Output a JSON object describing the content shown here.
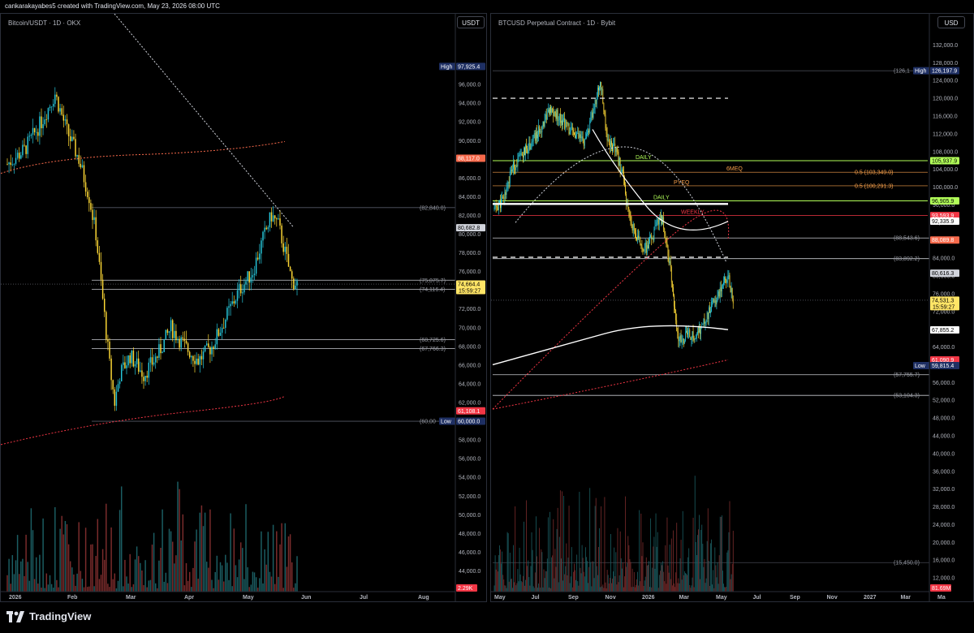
{
  "header": {
    "text": "cankarakayabes5 created with TradingView.com, May 23, 2026 08:00 UTC"
  },
  "footer": {
    "brand": "TradingView"
  },
  "chart_data": [
    {
      "type": "candlestick",
      "title": "Bitcoin/USDT · 1D · OKX",
      "currency": "USDT",
      "ylim": [
        43000,
        100000
      ],
      "yticks": [
        "96,000.0",
        "94,000.0",
        "92,000.0",
        "90,000.0",
        "88,000.0",
        "86,000.0",
        "84,000.0",
        "82,000.0",
        "80,000.0",
        "78,000.0",
        "76,000.0",
        "74,000.0",
        "72,000.0",
        "70,000.0",
        "68,000.0",
        "66,000.0",
        "64,000.0",
        "62,000.0",
        "60,000.0",
        "58,000.0",
        "56,000.0",
        "54,000.0",
        "52,000.0",
        "50,000.0",
        "48,000.0",
        "46,000.0",
        "44,000.0"
      ],
      "xticks": [
        "2026",
        "Feb",
        "Mar",
        "Apr",
        "May",
        "Jun",
        "Jul",
        "Aug"
      ],
      "price_path": [
        [
          0,
          87500
        ],
        [
          10,
          89000
        ],
        [
          20,
          92000
        ],
        [
          28,
          95000
        ],
        [
          35,
          91000
        ],
        [
          42,
          88000
        ],
        [
          48,
          84000
        ],
        [
          52,
          80000
        ],
        [
          56,
          73000
        ],
        [
          60,
          66000
        ],
        [
          63,
          62000
        ],
        [
          66,
          65000
        ],
        [
          72,
          67000
        ],
        [
          80,
          65000
        ],
        [
          88,
          67000
        ],
        [
          96,
          70000
        ],
        [
          104,
          68000
        ],
        [
          112,
          66500
        ],
        [
          120,
          68000
        ],
        [
          128,
          71000
        ],
        [
          136,
          74000
        ],
        [
          144,
          76000
        ],
        [
          150,
          79500
        ],
        [
          155,
          82000
        ],
        [
          159,
          81000
        ],
        [
          163,
          78000
        ],
        [
          167,
          75000
        ],
        [
          170,
          74700
        ]
      ],
      "levels": [
        {
          "value": 82840.0,
          "label": "(82,840.0)",
          "color": "#555a66"
        },
        {
          "value": 75075.7,
          "label": "(75,075.7)",
          "color": "#c8cad0"
        },
        {
          "value": 74116.4,
          "label": "(74,116.4)",
          "color": "#c8cad0"
        },
        {
          "value": 68725.6,
          "label": "(68,725.6)",
          "color": "#c8cad0"
        },
        {
          "value": 67766.3,
          "label": "(67,766.3)",
          "color": "#c8cad0"
        },
        {
          "value": 60000.0,
          "label": "(60,00",
          "color": "#555a66"
        }
      ],
      "price_tags": [
        {
          "value": 97925.4,
          "prefix": "High",
          "text": "97,925.4",
          "bg": "#1e2f63",
          "fg": "#ffffff"
        },
        {
          "value": 88117.0,
          "text": "88,117.0",
          "bg": "#f7694b",
          "fg": "#ffffff"
        },
        {
          "value": 80682.8,
          "text": "80,682.8",
          "bg": "#d1d4dc",
          "fg": "#000000"
        },
        {
          "value": 74664.4,
          "text": "74,664.4",
          "sub": "15:59:27",
          "bg": "#ffe566",
          "fg": "#000000"
        },
        {
          "value": 61108.1,
          "text": "61,108.1",
          "bg": "#f23645",
          "fg": "#ffffff"
        },
        {
          "value": 60000.0,
          "prefix": "Low",
          "text": "60,000.0",
          "bg": "#1e2f63",
          "fg": "#ffffff"
        }
      ],
      "volume_label": "2.29K",
      "colors": {
        "bull": "#26c6da",
        "bear": "#fdd835",
        "ma": "#f7694b",
        "trend": "#d1d4dc"
      }
    },
    {
      "type": "candlestick",
      "title": "BTCUSD Perpetual Contract · 1D · Bybit",
      "currency": "USD",
      "ylim": [
        8000,
        135000
      ],
      "yticks": [
        "132,000.0",
        "128,000.0",
        "124,000.0",
        "120,000.0",
        "116,000.0",
        "112,000.0",
        "108,000.0",
        "104,000.0",
        "100,000.0",
        "96,000.0",
        "92,000.0",
        "88,000.0",
        "84,000.0",
        "80,000.0",
        "76,000.0",
        "72,000.0",
        "68,000.0",
        "64,000.0",
        "60,000.0",
        "56,000.0",
        "52,000.0",
        "48,000.0",
        "44,000.0",
        "40,000.0",
        "36,000.0",
        "32,000.0",
        "28,000.0",
        "24,000.0",
        "20,000.0",
        "16,000.0",
        "12,000.0"
      ],
      "xticks": [
        "May",
        "Jul",
        "Sep",
        "Nov",
        "2026",
        "Mar",
        "May",
        "Jul",
        "Sep",
        "Nov",
        "2027",
        "Mar",
        "Ma"
      ],
      "price_path": [
        [
          0,
          95000
        ],
        [
          10,
          97000
        ],
        [
          20,
          104000
        ],
        [
          35,
          108000
        ],
        [
          50,
          112000
        ],
        [
          62,
          117000
        ],
        [
          75,
          116000
        ],
        [
          90,
          112000
        ],
        [
          105,
          110000
        ],
        [
          115,
          118000
        ],
        [
          122,
          124000
        ],
        [
          130,
          111000
        ],
        [
          140,
          108000
        ],
        [
          148,
          103000
        ],
        [
          152,
          96000
        ],
        [
          158,
          92000
        ],
        [
          165,
          88000
        ],
        [
          175,
          86000
        ],
        [
          185,
          90000
        ],
        [
          192,
          94000
        ],
        [
          198,
          88000
        ],
        [
          205,
          78000
        ],
        [
          210,
          67000
        ],
        [
          215,
          65000
        ],
        [
          222,
          67000
        ],
        [
          232,
          66000
        ],
        [
          240,
          69000
        ],
        [
          250,
          73000
        ],
        [
          258,
          76000
        ],
        [
          265,
          80000
        ],
        [
          270,
          79000
        ],
        [
          275,
          75000
        ]
      ],
      "levels": [
        {
          "value": 126198.0,
          "label": "(126,1",
          "color": "#434651"
        },
        {
          "value": 88543.6,
          "label": "(88,543.6)",
          "color": "#c8cad0"
        },
        {
          "value": 83892.2,
          "label": "(83,892.2)",
          "color": "#c8cad0"
        },
        {
          "value": 57755.7,
          "label": "(57,755.7)",
          "color": "#c8cad0"
        },
        {
          "value": 53104.3,
          "label": "(53,104.3)",
          "color": "#c8cad0"
        },
        {
          "value": 15450.0,
          "label": "(15,450.0)",
          "color": "#434651"
        }
      ],
      "annotations": [
        {
          "value": 105937.9,
          "label": "DAILY",
          "color": "#b2ff59"
        },
        {
          "value": 103349.0,
          "label": "6MEQ",
          "right": "0.5 (103,349.0)",
          "color": "#f7a04b"
        },
        {
          "value": 100291.3,
          "label": "PYEQ",
          "right": "0.5 (100,291.3)",
          "color": "#f7a04b"
        },
        {
          "value": 96905.9,
          "label": "DAILY",
          "color": "#b2ff59"
        },
        {
          "value": 93593.9,
          "label": "WEEKLY",
          "color": "#f23645"
        }
      ],
      "price_tags": [
        {
          "value": 126197.9,
          "prefix": "High",
          "text": "126,197.9",
          "bg": "#1e2f63",
          "fg": "#ffffff"
        },
        {
          "value": 105937.9,
          "text": "105,937.9",
          "bg": "#b2ff59",
          "fg": "#000000"
        },
        {
          "value": 96905.9,
          "text": "96,905.9",
          "bg": "#b2ff59",
          "fg": "#000000"
        },
        {
          "value": 93593.9,
          "text": "93,593.9",
          "bg": "#f23645",
          "fg": "#ffffff"
        },
        {
          "value": 92335.9,
          "text": "92,335.9",
          "bg": "#ffffff",
          "fg": "#000000"
        },
        {
          "value": 88089.8,
          "text": "88,089.8",
          "bg": "#f7694b",
          "fg": "#ffffff"
        },
        {
          "value": 80616.3,
          "text": "80,616.3",
          "bg": "#d1d4dc",
          "fg": "#000000"
        },
        {
          "value": 74531.3,
          "text": "74,531.3",
          "sub": "15:59:27",
          "bg": "#ffe566",
          "fg": "#000000"
        },
        {
          "value": 67855.2,
          "text": "67,855.2",
          "bg": "#ffffff",
          "fg": "#000000"
        },
        {
          "value": 61090.9,
          "text": "61,090.9",
          "bg": "#f23645",
          "fg": "#ffffff"
        },
        {
          "value": 59815.4,
          "prefix": "Low",
          "text": "59,815.4",
          "bg": "#1e2f63",
          "fg": "#ffffff"
        }
      ],
      "volume_label": "81.69M",
      "colors": {
        "bull": "#26c6da",
        "bear": "#fdd835",
        "ma": "#f7694b",
        "trend": "#d1d4dc"
      }
    }
  ]
}
